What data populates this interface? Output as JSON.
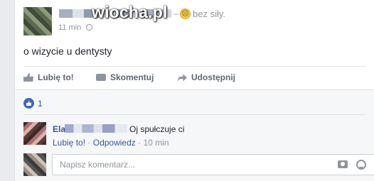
{
  "post": {
    "watermark": "wiocha.pl",
    "separator": "–",
    "feeling_emoji": "☹",
    "feeling": "bez siły.",
    "time": "11 min",
    "text": "o wizycie u dentysty"
  },
  "actions": {
    "like": "Lubię to!",
    "comment": "Skomentuj",
    "share": "Udostępnij"
  },
  "likes": {
    "count": "1"
  },
  "comment": {
    "author": "Ela",
    "text": "Oj spułczuje ci",
    "like": "Lubię to!",
    "dot": "·",
    "reply": "Odpowiedz",
    "time": "10 min"
  },
  "composer": {
    "placeholder": "Napisz komentarz..."
  },
  "colors": {
    "link": "#365899",
    "muted": "#90949c",
    "background": "#e9ebee"
  }
}
